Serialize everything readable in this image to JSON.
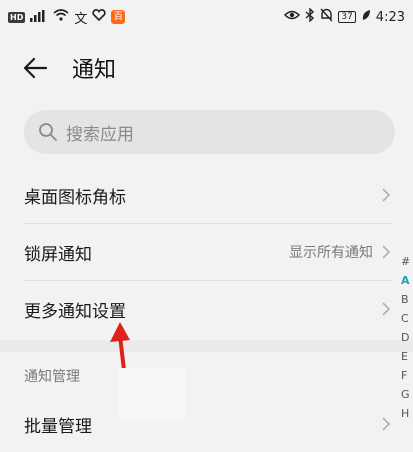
{
  "status_bar": {
    "left_badge": "HD",
    "signal": "⁴ᴳ",
    "app_badge": "百",
    "battery": "37",
    "time": "4:23"
  },
  "header": {
    "title": "通知"
  },
  "search": {
    "placeholder": "搜索应用"
  },
  "rows": [
    {
      "label": "桌面图标角标",
      "value": ""
    },
    {
      "label": "锁屏通知",
      "value": "显示所有通知"
    },
    {
      "label": "更多通知设置",
      "value": ""
    }
  ],
  "section": {
    "title": "通知管理"
  },
  "section_rows": [
    {
      "label": "批量管理"
    }
  ],
  "alpha_index": [
    "#",
    "A",
    "B",
    "C",
    "D",
    "E",
    "F",
    "G",
    "H"
  ],
  "colors": {
    "accent": "#1aa3b5",
    "annotation_arrow": "#e0211b"
  }
}
